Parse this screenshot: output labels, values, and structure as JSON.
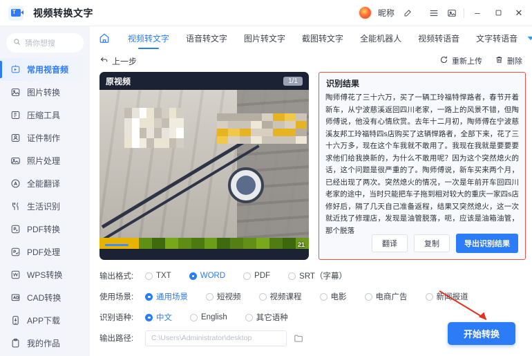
{
  "titlebar": {
    "app_title": "视频转换文字",
    "logo_icon": "video-text-logo-icon",
    "nickname": "昵称",
    "edit_icon": "edit-profile-icon",
    "menu_icon": "hamburger-menu-icon",
    "skin_icon": "theme-skin-icon",
    "minimize": "–",
    "maximize": "▫",
    "close": "✕"
  },
  "sidebar": {
    "search": {
      "placeholder": "猜你想搜",
      "icon": "search-icon"
    },
    "items": [
      {
        "label": "常用视音频",
        "icon": "video-icon",
        "active": true
      },
      {
        "label": "图片转换",
        "icon": "image-icon",
        "active": false
      },
      {
        "label": "压缩工具",
        "icon": "compress-icon",
        "active": false
      },
      {
        "label": "证件制作",
        "icon": "id-card-icon",
        "active": false
      },
      {
        "label": "照片处理",
        "icon": "photo-icon",
        "active": false
      },
      {
        "label": "全能翻译",
        "icon": "translate-icon",
        "active": false
      },
      {
        "label": "生活识别",
        "icon": "life-scan-icon",
        "active": false
      },
      {
        "label": "PDF转换",
        "icon": "pdf-convert-icon",
        "active": false
      },
      {
        "label": "PDF处理",
        "icon": "pdf-edit-icon",
        "active": false
      },
      {
        "label": "WPS转换",
        "icon": "wps-icon",
        "active": false
      },
      {
        "label": "CAD转换",
        "icon": "cad-icon",
        "active": false
      },
      {
        "label": "APP下载",
        "icon": "app-download-icon",
        "active": false
      },
      {
        "label": "我的作品",
        "icon": "my-works-icon",
        "active": false
      }
    ]
  },
  "tabbar": {
    "home_icon": "home-icon",
    "more_icon": "chevron-down-icon",
    "tabs": [
      {
        "label": "视频转文字",
        "active": true
      },
      {
        "label": "语音转文字",
        "active": false
      },
      {
        "label": "图片转文字",
        "active": false
      },
      {
        "label": "截图转文字",
        "active": false
      },
      {
        "label": "全能机器人",
        "active": false
      },
      {
        "label": "视频转语音",
        "active": false
      },
      {
        "label": "文字转语音",
        "active": false
      }
    ]
  },
  "actionbar": {
    "back_label": "上一步",
    "back_icon": "back-arrow-icon",
    "reupload_label": "重新上传",
    "reupload_icon": "refresh-icon",
    "delete_label": "删除",
    "delete_icon": "trash-icon"
  },
  "video_panel": {
    "title": "原视频",
    "count": "1/1",
    "timestamp": "21"
  },
  "result_panel": {
    "title": "识别结果",
    "text": "陶师傅花了三十六万，买了一辆工玲福特悍路者，春节开着新车，从宁波慈溪返回四川老家，一路上的风景不错，但陶师傅说，他没有心情欣赏。去年十二月初，陶师傅在宁波慈溪友邦工玲福特四s店购买了这辆悍路者，全部下来，花了三十六万多，现在这个车我就不敢用了。我现在我就是要要要求他们给我换新的，为什么不敢用呢？因为这个突然熄火的话，这个问题是很严重的了。陶师傅说，新车买来两个月，已经出现了两次。突然熄火的情况，一次是年前开车回四川老家的途中，当时只能把车子拖到相对较大的重庆一家四s店修好后，隔了几天自己准备返程，结果又突然熄火，这一次就近找了修理店，发现是油管脱落，呃，应该是油箱油管，那个脱落",
    "buttons": {
      "translate": "翻译",
      "copy": "复制",
      "export": "导出识别结果"
    },
    "border_color": "#e8523f"
  },
  "options": {
    "format": {
      "label": "输出格式:",
      "choices": [
        {
          "label": "TXT",
          "selected": false
        },
        {
          "label": "WORD",
          "selected": true
        },
        {
          "label": "PDF",
          "selected": false
        },
        {
          "label": "SRT（字幕）",
          "selected": false
        }
      ]
    },
    "scene": {
      "label": "使用场景:",
      "choices": [
        {
          "label": "通用场景",
          "selected": true
        },
        {
          "label": "短视频",
          "selected": false
        },
        {
          "label": "视频课程",
          "selected": false
        },
        {
          "label": "电影",
          "selected": false
        },
        {
          "label": "电商广告",
          "selected": false
        },
        {
          "label": "新闻报道",
          "selected": false
        }
      ]
    },
    "language": {
      "label": "识别语种:",
      "choices": [
        {
          "label": "中文",
          "selected": true
        },
        {
          "label": "English",
          "selected": false
        },
        {
          "label": "其它语种",
          "selected": false
        }
      ]
    },
    "output_path": {
      "label": "输出路径:",
      "value": "C:\\Users\\Administrator\\desktop",
      "folder_icon": "folder-browse-icon"
    }
  },
  "start_button": {
    "label": "开始转换",
    "color": "#2b7cf6"
  },
  "annotation": {
    "arrow_icon": "red-pointer-arrow-icon",
    "color": "#e03423"
  }
}
